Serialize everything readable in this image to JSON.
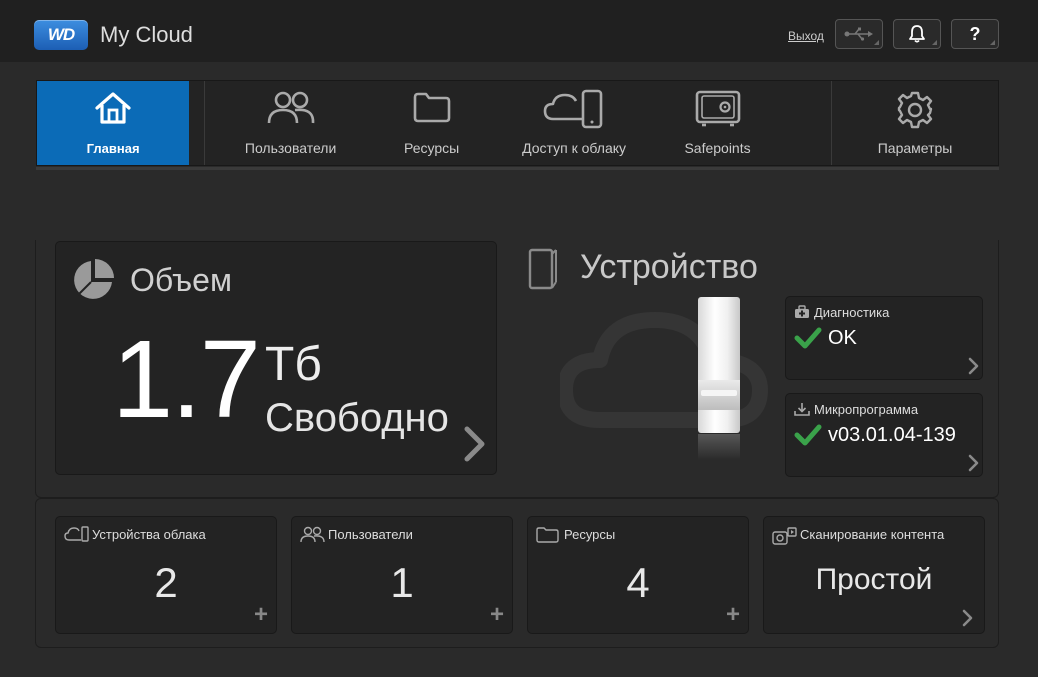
{
  "header": {
    "logo_text": "WD",
    "app_title": "My Cloud",
    "logout_label": "Выход",
    "usb_icon": "usb-icon",
    "bell_icon": "bell-icon",
    "help_label": "?"
  },
  "nav": {
    "items": [
      {
        "label": "Главная",
        "icon": "home-icon",
        "active": true
      },
      {
        "label": "Пользователи",
        "icon": "users-icon",
        "active": false
      },
      {
        "label": "Ресурсы",
        "icon": "folder-icon",
        "active": false
      },
      {
        "label": "Доступ к облаку",
        "icon": "cloud-device-icon",
        "active": false
      },
      {
        "label": "Safepoints",
        "icon": "safe-icon",
        "active": false
      },
      {
        "label": "Параметры",
        "icon": "gear-icon",
        "active": false
      }
    ]
  },
  "capacity": {
    "title": "Объем",
    "value": "1.7",
    "unit": "Тб",
    "state": "Свободно"
  },
  "device": {
    "title": "Устройство",
    "diagnostics": {
      "label": "Диагностика",
      "value": "OK"
    },
    "firmware": {
      "label": "Микропрограмма",
      "value": "v03.01.04-139"
    }
  },
  "tiles": [
    {
      "label": "Устройства облака",
      "value": "2",
      "icon": "cloud-devices-icon",
      "action": "plus"
    },
    {
      "label": "Пользователи",
      "value": "1",
      "icon": "users-icon",
      "action": "plus"
    },
    {
      "label": "Ресурсы",
      "value": "4",
      "icon": "folder-icon",
      "action": "plus"
    },
    {
      "label": "Сканирование контента",
      "value": "Простой",
      "icon": "media-scan-icon",
      "action": "chevron"
    }
  ],
  "colors": {
    "accent": "#0b6bb7",
    "ok_check": "#3aa24a",
    "background": "#2a2a2a"
  }
}
